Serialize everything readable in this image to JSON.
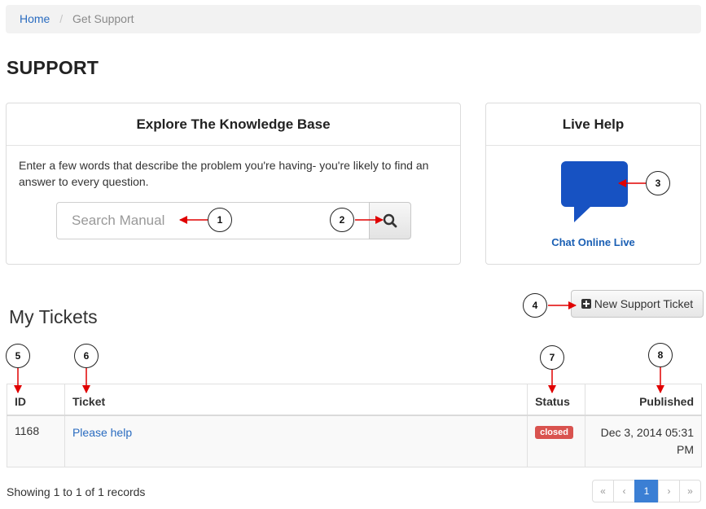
{
  "breadcrumb": {
    "home": "Home",
    "separator": "/",
    "current": "Get Support"
  },
  "page": {
    "title": "SUPPORT"
  },
  "knowledge_base": {
    "title": "Explore The Knowledge Base",
    "description": "Enter a few words that describe the problem you're having- you're likely to find an answer to every question.",
    "search_placeholder": "Search Manual",
    "search_value": ""
  },
  "live_help": {
    "title": "Live Help",
    "chat_label": "Chat Online Live",
    "bubble_color": "#1752c2"
  },
  "tickets": {
    "title": "My Tickets",
    "new_button": "New Support Ticket",
    "columns": {
      "id": "ID",
      "ticket": "Ticket",
      "status": "Status",
      "published": "Published"
    },
    "rows": [
      {
        "id": "1168",
        "ticket": "Please help",
        "status": "closed",
        "published": "Dec 3, 2014 05:31 PM"
      }
    ],
    "records_text": "Showing 1 to 1 of 1 records"
  },
  "pagination": {
    "first": "«",
    "prev": "‹",
    "current": "1",
    "next": "›",
    "last": "»"
  },
  "annotations": {
    "c1": "1",
    "c2": "2",
    "c3": "3",
    "c4": "4",
    "c5": "5",
    "c6": "6",
    "c7": "7",
    "c8": "8"
  },
  "colors": {
    "link": "#2a6cc0",
    "status_closed": "#d9534f",
    "arrow": "#e00000",
    "active_page": "#3b7fd4"
  }
}
